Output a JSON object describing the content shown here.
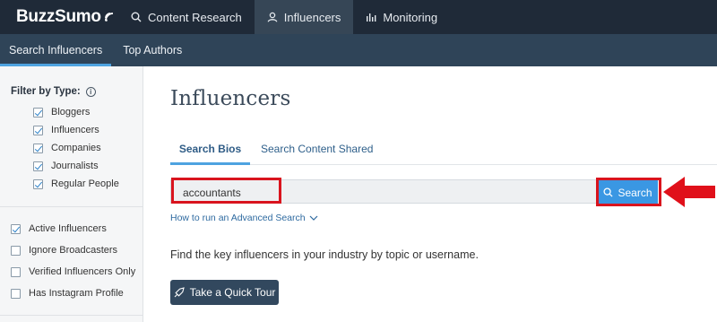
{
  "topnav": {
    "logo": "BuzzSumo",
    "items": [
      {
        "label": "Content Research",
        "icon": "search-icon"
      },
      {
        "label": "Influencers",
        "icon": "user-icon",
        "active": true
      },
      {
        "label": "Monitoring",
        "icon": "bar-chart-icon"
      }
    ]
  },
  "subnav": {
    "items": [
      {
        "label": "Search Influencers",
        "active": true
      },
      {
        "label": "Top Authors"
      }
    ]
  },
  "sidebar": {
    "filter_title": "Filter by Type:",
    "types": [
      {
        "label": "Bloggers",
        "checked": true
      },
      {
        "label": "Influencers",
        "checked": true
      },
      {
        "label": "Companies",
        "checked": true
      },
      {
        "label": "Journalists",
        "checked": true
      },
      {
        "label": "Regular People",
        "checked": true
      }
    ],
    "options": [
      {
        "label": "Active Influencers",
        "checked": true
      },
      {
        "label": "Ignore Broadcasters",
        "checked": false
      },
      {
        "label": "Verified Influencers Only",
        "checked": false
      },
      {
        "label": "Has Instagram Profile",
        "checked": false
      }
    ]
  },
  "main": {
    "title": "Influencers",
    "tabs": [
      {
        "label": "Search Bios",
        "active": true
      },
      {
        "label": "Search Content Shared"
      }
    ],
    "search": {
      "value": "accountants",
      "button_label": "Search"
    },
    "advanced_link": "How to run an Advanced Search",
    "description": "Find the key influencers in your industry by topic or username.",
    "tour_button": "Take a Quick Tour"
  },
  "colors": {
    "topnav_bg": "#1f2a38",
    "subnav_bg": "#2f4458",
    "accent": "#3a97e3",
    "highlight": "#d9141e"
  }
}
